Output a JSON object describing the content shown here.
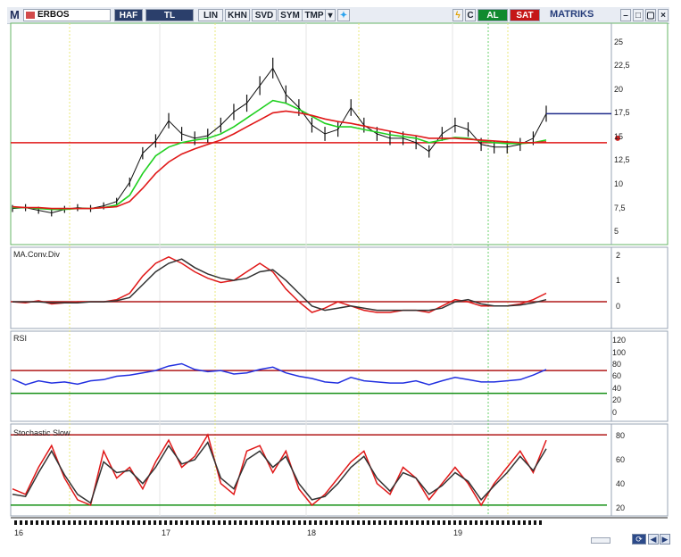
{
  "toolbar": {
    "logo": "M",
    "symbol": "ERBOS",
    "period": "HAF",
    "currency": "TL",
    "buttons": [
      "LIN",
      "KHN",
      "SVD",
      "SYM",
      "TMP"
    ],
    "buy": "AL",
    "sell": "SAT",
    "brand": "MATRIKS",
    "icons": [
      "dropdown-icon",
      "twitter-bird-icon",
      "lightning-icon",
      "c-icon",
      "window-icons"
    ]
  },
  "colors": {
    "price_line": "#111111",
    "ema_short": "#20d020",
    "ema_long": "#e01818",
    "support": "#e01818",
    "last_price": "#1e2a8a",
    "rsi": "#2230e0",
    "macd": "#e01818",
    "signal": "#333333",
    "vline_yellow": "#e8e87a",
    "vline_green": "#68d068",
    "band_red": "#b01818",
    "band_green": "#169016"
  },
  "panels": {
    "price": {
      "y_ticks": [
        "25",
        "22,5",
        "20",
        "17,5",
        "15",
        "12,5",
        "10",
        "7,5",
        "5"
      ]
    },
    "macd": {
      "label": "MA.Conv.Div",
      "y_ticks": [
        "2",
        "1",
        "0"
      ]
    },
    "rsi": {
      "label": "RSI",
      "y_ticks": [
        "120",
        "100",
        "80",
        "60",
        "40",
        "20",
        "0"
      ]
    },
    "stoch": {
      "label": "Stochastic Slow",
      "y_ticks": [
        "80",
        "60",
        "40",
        "20"
      ]
    }
  },
  "x_labels": [
    "16",
    "17",
    "18",
    "19"
  ],
  "chart_data": [
    {
      "type": "line",
      "title": "ERBOS",
      "x": [
        "16",
        "17",
        "18",
        "19"
      ],
      "ylim": [
        4,
        28
      ],
      "series": [
        {
          "values": [
            7.5,
            7.6,
            7.3,
            7.0,
            7.4,
            7.6,
            7.5,
            7.8,
            8.3,
            10.5,
            13.8,
            15.2,
            17.5,
            16.0,
            15.5,
            15.8,
            17.0,
            18.5,
            19.5,
            21.5,
            23.5,
            20.5,
            19.0,
            17.0,
            16.0,
            16.5,
            19.0,
            17.0,
            16.0,
            15.5,
            15.5,
            15.0,
            14.0,
            16.0,
            17.0,
            16.5,
            14.8,
            14.5,
            14.5,
            14.8,
            15.5,
            18.3
          ]
        },
        {
          "values": [
            7.6,
            7.6,
            7.5,
            7.4,
            7.4,
            7.5,
            7.5,
            7.6,
            7.9,
            9.0,
            11.5,
            13.5,
            14.5,
            15.0,
            15.3,
            15.5,
            16.0,
            16.8,
            17.8,
            18.8,
            19.8,
            19.5,
            18.8,
            18.0,
            17.2,
            16.8,
            16.8,
            16.5,
            16.2,
            15.9,
            15.7,
            15.5,
            15.0,
            15.3,
            15.6,
            15.5,
            15.2,
            15.0,
            14.9,
            14.9,
            15.0,
            15.3
          ]
        },
        {
          "values": [
            7.7,
            7.6,
            7.6,
            7.5,
            7.5,
            7.5,
            7.5,
            7.6,
            7.7,
            8.3,
            9.8,
            11.5,
            12.8,
            13.7,
            14.3,
            14.8,
            15.3,
            16.0,
            16.8,
            17.6,
            18.4,
            18.6,
            18.4,
            18.1,
            17.7,
            17.4,
            17.2,
            16.9,
            16.6,
            16.3,
            16.0,
            15.8,
            15.5,
            15.5,
            15.5,
            15.4,
            15.3,
            15.2,
            15.1,
            15.0,
            15.0,
            15.1
          ]
        }
      ]
    },
    {
      "type": "line",
      "title": "MA.Conv.Div",
      "x": [
        "16",
        "17",
        "18",
        "19"
      ],
      "ylim": [
        -1,
        2.3
      ],
      "series": [
        {
          "values": [
            0.0,
            -0.05,
            0.05,
            -0.1,
            -0.05,
            0.0,
            0.0,
            0.0,
            0.1,
            0.4,
            1.2,
            1.8,
            2.1,
            1.8,
            1.4,
            1.1,
            0.9,
            1.0,
            1.4,
            1.8,
            1.4,
            0.6,
            0.0,
            -0.5,
            -0.3,
            0.0,
            -0.2,
            -0.4,
            -0.5,
            -0.5,
            -0.4,
            -0.4,
            -0.5,
            -0.2,
            0.1,
            0.0,
            -0.2,
            -0.2,
            -0.2,
            -0.1,
            0.1,
            0.4
          ]
        },
        {
          "values": [
            0.0,
            0.0,
            0.0,
            -0.05,
            -0.05,
            -0.05,
            0.0,
            0.0,
            0.05,
            0.2,
            0.8,
            1.4,
            1.8,
            2.0,
            1.6,
            1.3,
            1.1,
            1.0,
            1.1,
            1.4,
            1.5,
            1.0,
            0.4,
            -0.2,
            -0.4,
            -0.3,
            -0.2,
            -0.3,
            -0.4,
            -0.4,
            -0.4,
            -0.4,
            -0.4,
            -0.3,
            0.0,
            0.1,
            -0.1,
            -0.2,
            -0.2,
            -0.15,
            -0.05,
            0.1
          ]
        }
      ]
    },
    {
      "type": "line",
      "title": "RSI",
      "x": [
        "16",
        "17",
        "18",
        "19"
      ],
      "ylim": [
        -10,
        130
      ],
      "series": [
        {
          "values": [
            55,
            45,
            52,
            48,
            50,
            46,
            52,
            54,
            60,
            62,
            66,
            70,
            78,
            82,
            72,
            68,
            70,
            64,
            66,
            72,
            76,
            66,
            60,
            56,
            50,
            48,
            58,
            52,
            50,
            48,
            48,
            52,
            45,
            52,
            58,
            54,
            50,
            50,
            52,
            54,
            62,
            72
          ]
        }
      ]
    },
    {
      "type": "line",
      "title": "Stochastic Slow",
      "x": [
        "16",
        "17",
        "18",
        "19"
      ],
      "ylim": [
        15,
        90
      ],
      "series": [
        {
          "values": [
            35,
            30,
            55,
            75,
            45,
            25,
            20,
            70,
            45,
            55,
            35,
            60,
            80,
            55,
            65,
            85,
            40,
            30,
            70,
            75,
            50,
            70,
            35,
            20,
            30,
            45,
            60,
            70,
            40,
            30,
            55,
            45,
            25,
            40,
            55,
            40,
            20,
            40,
            55,
            70,
            50,
            80
          ]
        },
        {
          "values": [
            30,
            28,
            50,
            70,
            48,
            30,
            22,
            60,
            50,
            52,
            40,
            55,
            75,
            58,
            62,
            78,
            45,
            35,
            62,
            70,
            55,
            65,
            40,
            25,
            28,
            40,
            55,
            65,
            45,
            33,
            50,
            45,
            30,
            38,
            50,
            42,
            25,
            38,
            50,
            65,
            52,
            72
          ]
        }
      ]
    }
  ]
}
